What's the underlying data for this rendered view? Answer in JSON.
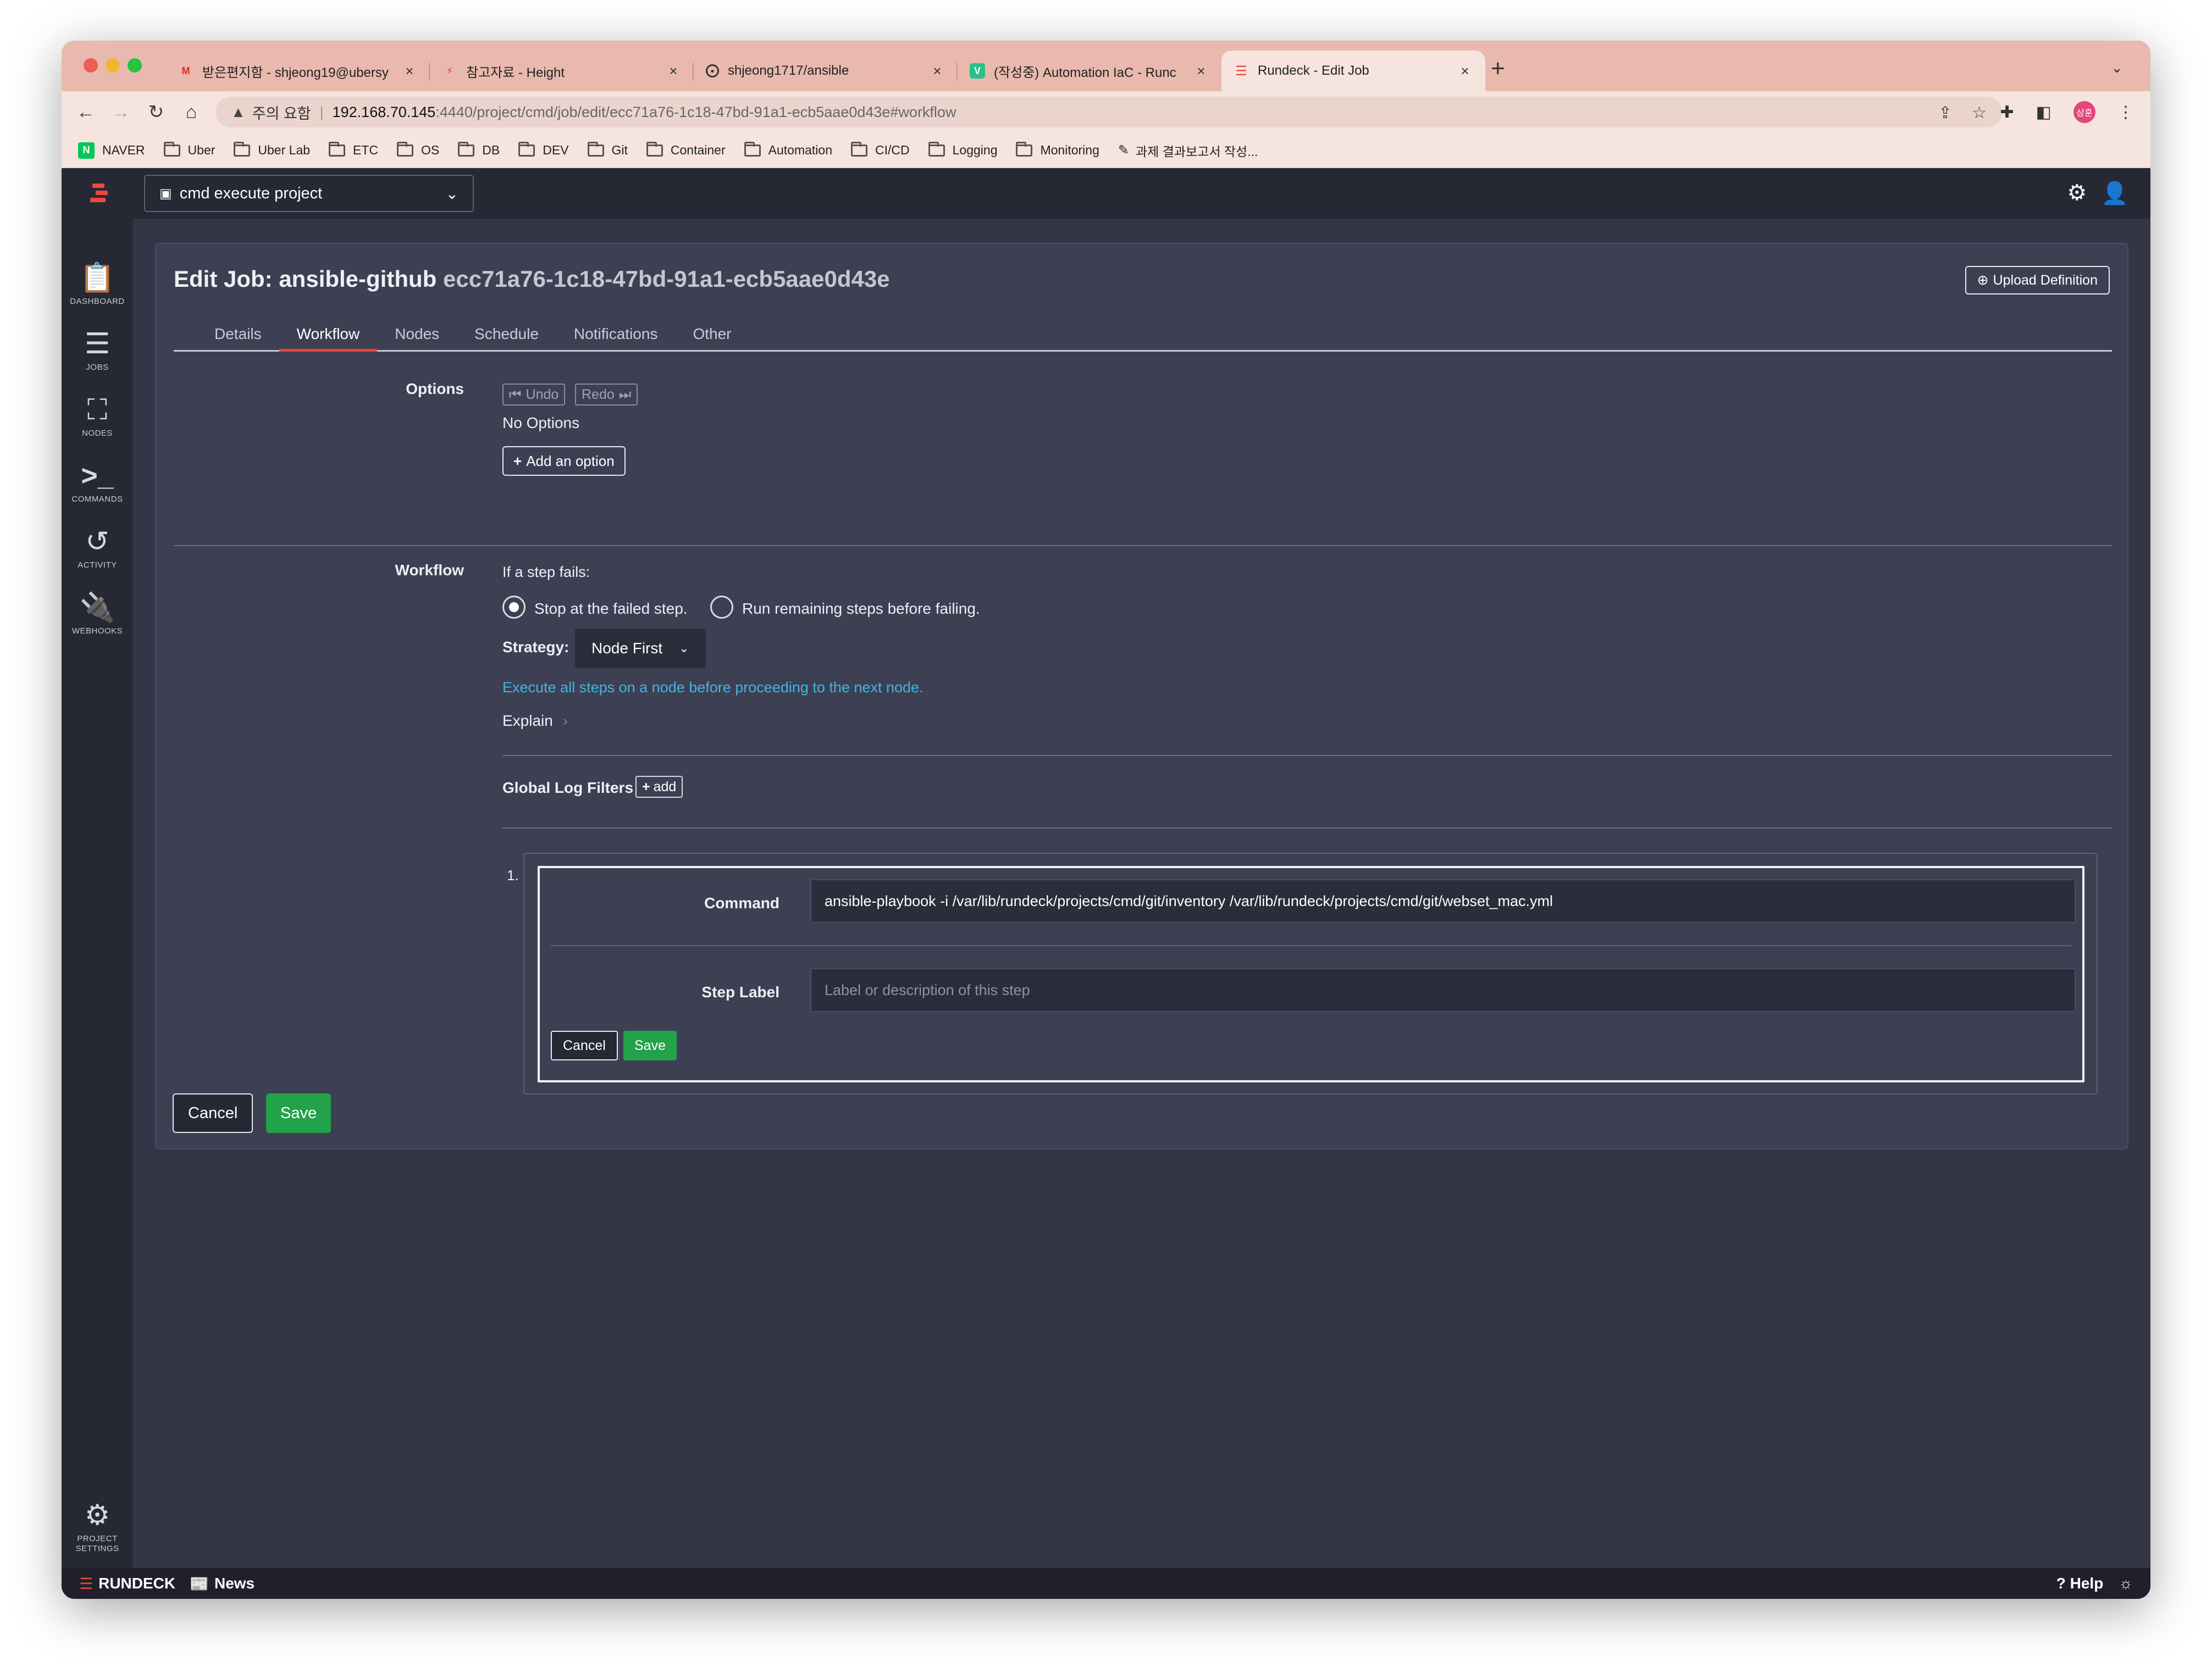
{
  "browser": {
    "tabs": [
      {
        "title": "받은편지함 - shjeong19@ubersy",
        "icon": "gmail-icon"
      },
      {
        "title": "참고자료 - Height",
        "icon": "height-icon"
      },
      {
        "title": "shjeong1717/ansible",
        "icon": "github-icon"
      },
      {
        "title": "(작성중) Automation IaC - Runc",
        "icon": "vuepress-icon"
      },
      {
        "title": "Rundeck - Edit Job",
        "icon": "rundeck-icon"
      }
    ],
    "active_tab": 4,
    "new_tab": "+",
    "security_label": "주의 요함",
    "url_host": "192.168.70.145",
    "url_path": ":4440/project/cmd/job/edit/ecc71a76-1c18-47bd-91a1-ecb5aae0d43e#workflow",
    "avatar_text": "상훈",
    "bookmarks": [
      {
        "label": "NAVER",
        "type": "naver"
      },
      {
        "label": "Uber",
        "type": "folder"
      },
      {
        "label": "Uber Lab",
        "type": "folder"
      },
      {
        "label": "ETC",
        "type": "folder"
      },
      {
        "label": "OS",
        "type": "folder"
      },
      {
        "label": "DB",
        "type": "folder"
      },
      {
        "label": "DEV",
        "type": "folder"
      },
      {
        "label": "Git",
        "type": "folder"
      },
      {
        "label": "Container",
        "type": "folder"
      },
      {
        "label": "Automation",
        "type": "folder"
      },
      {
        "label": "CI/CD",
        "type": "folder"
      },
      {
        "label": "Logging",
        "type": "folder"
      },
      {
        "label": "Monitoring",
        "type": "folder"
      },
      {
        "label": "과제 결과보고서 작성...",
        "type": "page"
      }
    ]
  },
  "app": {
    "project_selector": "cmd execute project",
    "sidebar": [
      {
        "label": "DASHBOARD",
        "icon": "clipboard-icon"
      },
      {
        "label": "JOBS",
        "icon": "list-icon"
      },
      {
        "label": "NODES",
        "icon": "sitemap-icon"
      },
      {
        "label": "COMMANDS",
        "icon": "terminal-icon"
      },
      {
        "label": "ACTIVITY",
        "icon": "history-icon"
      },
      {
        "label": "WEBHOOKS",
        "icon": "plug-icon"
      }
    ],
    "project_settings_line1": "PROJECT",
    "project_settings_line2": "SETTINGS"
  },
  "page": {
    "title_prefix": "Edit Job: ansible-github",
    "job_uuid": "ecc71a76-1c18-47bd-91a1-ecb5aae0d43e",
    "upload_definition": "Upload Definition",
    "tabs": [
      "Details",
      "Workflow",
      "Nodes",
      "Schedule",
      "Notifications",
      "Other"
    ],
    "active_tab": "Workflow"
  },
  "options": {
    "label": "Options",
    "undo": "Undo",
    "redo": "Redo",
    "no_options": "No Options",
    "add_option": "Add an option"
  },
  "workflow": {
    "label": "Workflow",
    "if_step_fails": "If a step fails:",
    "stop_label": "Stop at the failed step.",
    "run_remaining_label": "Run remaining steps before failing.",
    "selected": "stop",
    "strategy_label": "Strategy:",
    "strategy_value": "Node First",
    "strategy_description": "Execute all steps on a node before proceeding to the next node.",
    "explain": "Explain",
    "global_log_filters": "Global Log Filters",
    "add": "add"
  },
  "step": {
    "number": "1.",
    "command_label": "Command",
    "command_value": "ansible-playbook -i /var/lib/rundeck/projects/cmd/git/inventory /var/lib/rundeck/projects/cmd/git/webset_mac.yml",
    "step_label_label": "Step Label",
    "step_label_placeholder": "Label or description of this step",
    "cancel": "Cancel",
    "save": "Save"
  },
  "form": {
    "cancel": "Cancel",
    "save": "Save"
  },
  "footer": {
    "brand": "RUNDECK",
    "news": "News",
    "help": "Help"
  },
  "colors": {
    "accent": "#e8463c",
    "save_green": "#22a24a",
    "link_blue": "#3fb6e3",
    "nav_dark": "#262833",
    "card_bg": "#3d4053"
  }
}
